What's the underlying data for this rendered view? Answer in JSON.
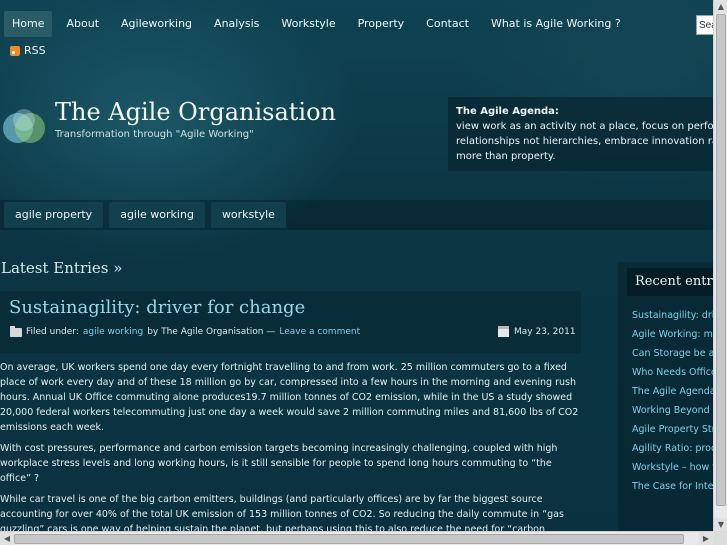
{
  "nav": {
    "items": [
      "Home",
      "About",
      "Agileworking",
      "Analysis",
      "Workstyle",
      "Property",
      "Contact",
      "What is Agile Working ?"
    ],
    "active": "Home"
  },
  "search": {
    "value": "Sea"
  },
  "rss": {
    "label": "RSS"
  },
  "header": {
    "title": "The Agile Organisation",
    "tagline": "Transformation through \"Agile Working\""
  },
  "agenda": {
    "title": "The Agile Agenda:",
    "lines": [
      "view work as an activity not a place, focus on performance",
      "relationships not hierarchies, embrace innovation rather tha",
      "more than property."
    ]
  },
  "tags": [
    "agile property",
    "agile working",
    "workstyle"
  ],
  "latest": {
    "heading": "Latest Entries »"
  },
  "post": {
    "title": "Sustainagility: driver for change",
    "filed_under": "Filed under:",
    "category": "agile working",
    "by": "by The Agile Organisation —",
    "comment_link": "Leave a comment",
    "date": "May 23, 2011",
    "paragraphs": [
      "On average, UK workers spend one day every fortnight travelling to and from work.  25 million commuters go to a fixed place of work every day and of these 18 million go by car, compressed into a few hours in the morning and evening rush hours.  Annual UK Office commuting alone produces19.7 million tonnes of CO2 emission, while in the US a study showed 20,000 federal workers telecommuting just one day a week would save 2 million commuting miles and 81,600 lbs of CO2 emissions each week.",
      "With cost pressures, performance and carbon emission targets becoming increasingly challenging, coupled with high workplace stress levels and long working hours, is it still sensible for people to spend long hours commuting to “the office” ?",
      "While car travel is one of the big carbon emitters, buildings (and particularly offices) are by far the biggest  source accounting for over 40% of the total UK emission of 153 million tonnes of CO2. So reducing the daily commute in “gas guzzling” cars is one way of helping sustain the planet, but perhaps using this to also reduce the need for “carbon guzzling” underutilised office space is even more effective in reducing carbon footprint."
    ]
  },
  "sidebar": {
    "heading": "Recent entri",
    "items": [
      "Sustainagility: drive",
      "Agile Working: mo",
      "Can Storage be as",
      "Who Needs Office",
      "The Agile Agenda",
      "Working Beyond B",
      "Agile Property Stra",
      "Agility Ratio: produ",
      "Workstyle – how y",
      "The Case for Inter"
    ]
  },
  "colors": {
    "background": "#0c3946",
    "link": "#7fd0ea",
    "title_link": "#9ad6ea",
    "rss": "#f08a24"
  }
}
